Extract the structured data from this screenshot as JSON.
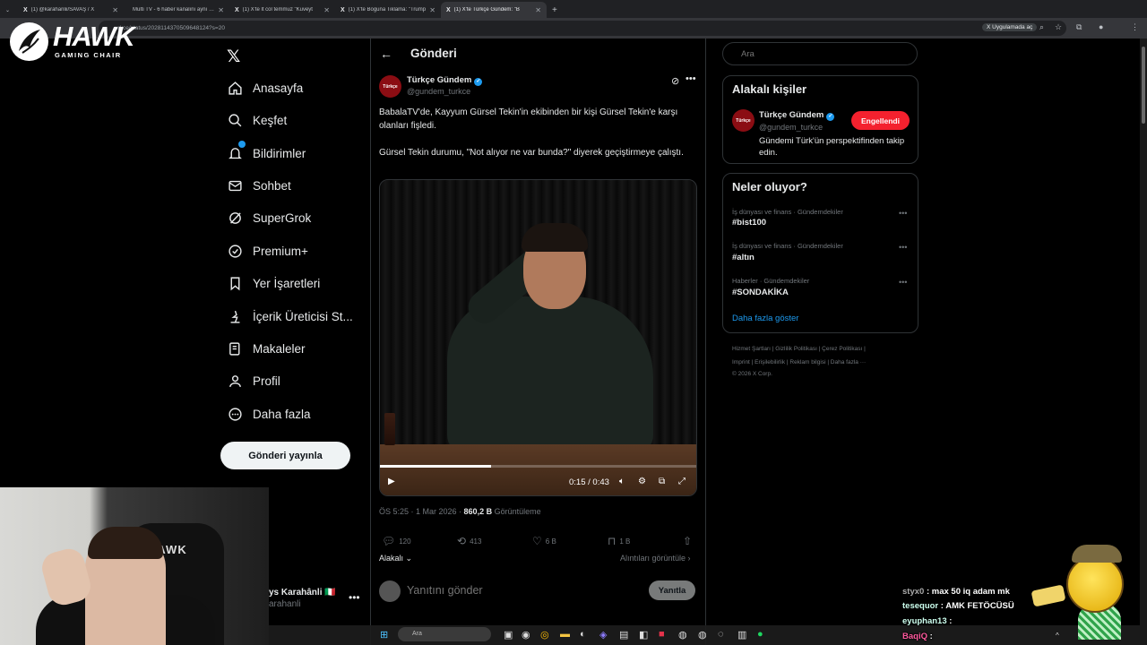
{
  "browser": {
    "tabs": [
      {
        "fav": "X",
        "label": "(1) @karahanlii/SAVAŞ / X",
        "close": "✕"
      },
      {
        "fav": "",
        "label": "Multi TV - 6 haber kanalını aynı anda izle",
        "close": "✕"
      },
      {
        "fav": "X",
        "label": "(1) X'te lt col temmuz \"Kuveyt",
        "close": "✕"
      },
      {
        "fav": "X",
        "label": "(1) X'te Boguna Tiklama: \"Trump",
        "close": "✕"
      },
      {
        "fav": "X",
        "label": "(1) X'te Türkçe Gündem: \"B",
        "close": "✕"
      }
    ],
    "new_tab": "+",
    "url": "urkce/status/2028114370509648124?s=20",
    "open_in_app": "Uygulamada aç"
  },
  "overlay_logo": {
    "title": "HAWK",
    "subtitle": "GAMING CHAIR"
  },
  "nav": {
    "items": [
      {
        "label": "Anasayfa",
        "icon": "home-icon"
      },
      {
        "label": "Keşfet",
        "icon": "search-icon"
      },
      {
        "label": "Bildirimler",
        "icon": "bell-icon"
      },
      {
        "label": "Sohbet",
        "icon": "mail-icon"
      },
      {
        "label": "SuperGrok",
        "icon": "grok-icon"
      },
      {
        "label": "Premium+",
        "icon": "premium-icon"
      },
      {
        "label": "Yer İşaretleri",
        "icon": "bookmark-icon"
      },
      {
        "label": "İçerik Üreticisi St...",
        "icon": "creator-studio-icon"
      },
      {
        "label": "Makaleler",
        "icon": "articles-icon"
      },
      {
        "label": "Profil",
        "icon": "profile-icon"
      },
      {
        "label": "Daha fazla",
        "icon": "more-icon"
      }
    ],
    "post_button": "Gönderi yayınla",
    "account_name": "ys Karahânli 🇮🇹",
    "account_handle": "arahanli",
    "account_more": "•••"
  },
  "main": {
    "title": "Gönderi",
    "author": {
      "avatar_text": "Türkçe",
      "name": "Türkçe Gündem",
      "handle": "@gundem_turkce"
    },
    "text_1": "BabalaTV'de, Kayyum Gürsel Tekin'in ekibinden bir kişi Gürsel Tekin'e karşı olanları fişledi.",
    "text_2": "Gürsel Tekin durumu, \"Not alıyor ne var bunda?\" diyerek geçiştirmeye çalıştı.",
    "video": {
      "time": "0:15 / 0:43",
      "progress": 0.35
    },
    "meta_time": "ÖS 5:25 · 1 Mar 2026 · ",
    "meta_views": "860,2 B",
    "meta_views_label": " Görüntüleme",
    "actions": {
      "replies": "120",
      "reposts": "413",
      "likes": "6 B",
      "bookmarks": "1 B"
    },
    "sort": "Alakalı ⌄",
    "quotes_link": "Alıntıları görüntüle ›",
    "reply_placeholder": "Yanıtını gönder",
    "reply_button": "Yanıtla"
  },
  "right": {
    "search_placeholder": "Ara",
    "related_title": "Alakalı kişiler",
    "related": {
      "avatar_text": "Türkçe",
      "name": "Türkçe Gündem",
      "handle": "@gundem_turkce",
      "bio": "Gündemi Türk'ün perspektifinden takip edin.",
      "button": "Engellendi"
    },
    "trends_title": "Neler oluyor?",
    "trends": [
      {
        "meta": "İş dünyası ve finans · Gündemdekiler",
        "name": "#bist100"
      },
      {
        "meta": "İş dünyası ve finans · Gündemdekiler",
        "name": "#altın"
      },
      {
        "meta": "Haberler · Gündemdekiler",
        "name": "#SONDAKİKA"
      }
    ],
    "show_more": "Daha fazla göster",
    "footer_1": "Hizmet Şartları  |  Gizlilik Politikası  |  Çerez Politikası  |",
    "footer_2": "Imprint  |  Erişilebilirlik  |  Reklam bilgisi  |  Daha fazla ···",
    "footer_3": "© 2026 X Corp."
  },
  "webcam": {
    "chair_text": "HAWK"
  },
  "chat": [
    {
      "user": "styx0",
      "msg": " : max 50 iq adam mk"
    },
    {
      "user": "tesequor",
      "msg": " : AMK FETÖCÜSÜ"
    },
    {
      "user": "eyuphan13",
      "msg": " : "
    },
    {
      "user": "BaqiQ",
      "msg": " : "
    }
  ],
  "taskbar": {
    "search_placeholder": "Ara"
  }
}
